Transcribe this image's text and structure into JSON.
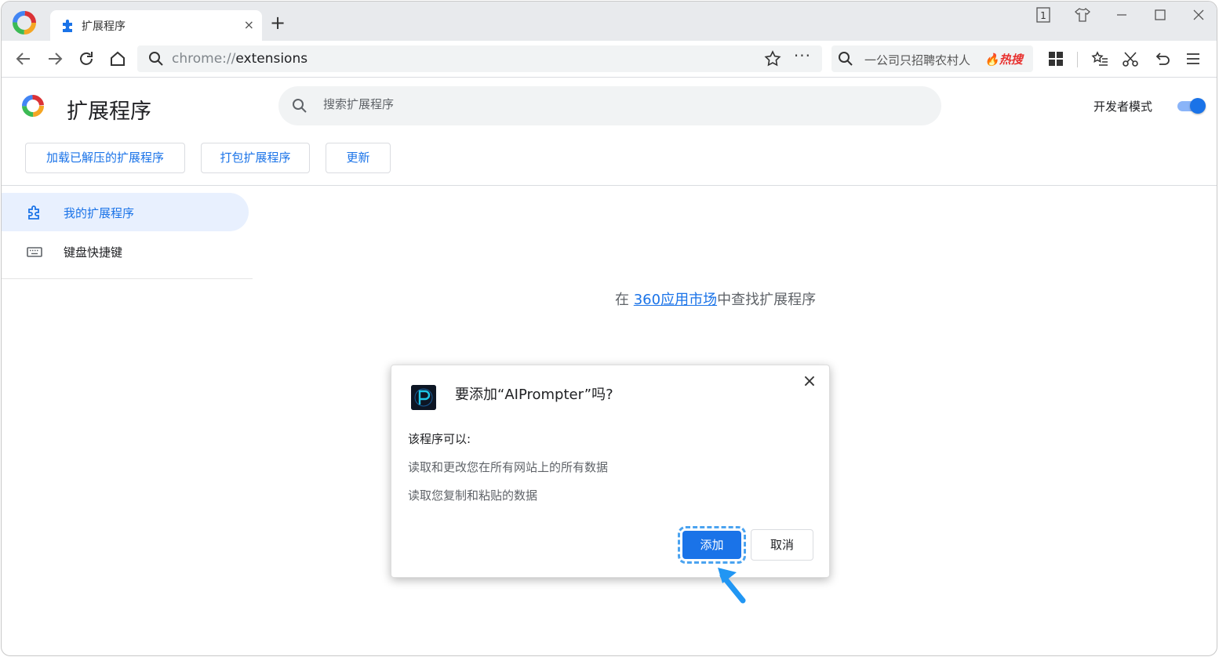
{
  "tab": {
    "title": "扩展程序",
    "close": "×"
  },
  "new_tab": "+",
  "window_controls": {
    "tab_count": "1"
  },
  "address_bar": {
    "scheme": "chrome://",
    "path": "extensions",
    "more": "···"
  },
  "search_box": {
    "text": "一公司只招聘农村人",
    "hot_badge": "热搜"
  },
  "page": {
    "title": "扩展程序",
    "search_placeholder": "搜索扩展程序",
    "developer_mode_label": "开发者模式",
    "developer_mode_on": true,
    "buttons": {
      "load_unpacked": "加载已解压的扩展程序",
      "pack": "打包扩展程序",
      "update": "更新"
    }
  },
  "sidebar": {
    "items": [
      {
        "label": "我的扩展程序",
        "icon": "puzzle-icon",
        "active": true
      },
      {
        "label": "键盘快捷键",
        "icon": "keyboard-icon",
        "active": false
      }
    ]
  },
  "market": {
    "prefix": "在 ",
    "link": "360应用市场",
    "suffix": "中查找扩展程序"
  },
  "dialog": {
    "title": "要添加“AIPrompter”吗?",
    "close": "×",
    "subtitle": "该程序可以:",
    "permissions": [
      "读取和更改您在所有网站上的所有数据",
      "读取您复制和粘贴的数据"
    ],
    "add_label": "添加",
    "cancel_label": "取消"
  },
  "colors": {
    "accent": "#1a73e8",
    "hot": "#e8312f",
    "highlight": "#4aa3f0"
  }
}
